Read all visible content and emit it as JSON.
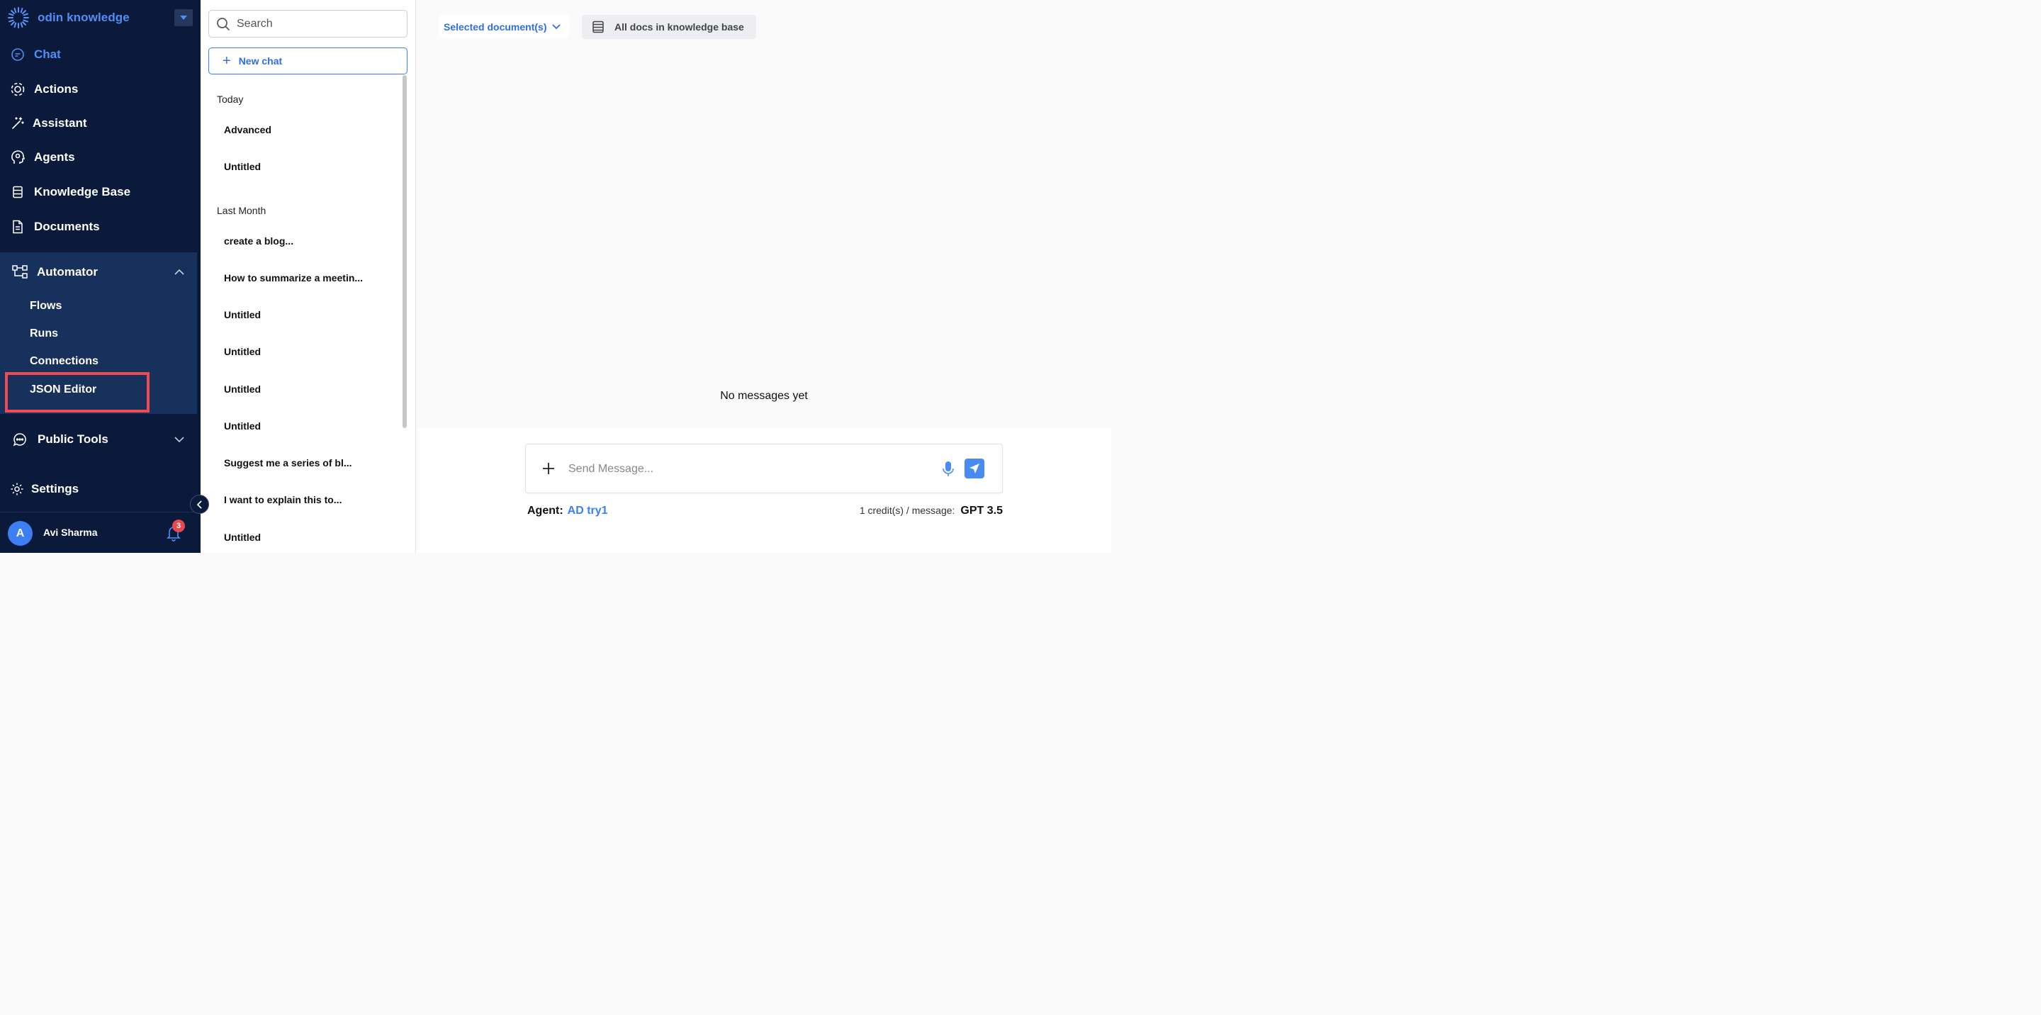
{
  "brand": {
    "name": "odin knowledge"
  },
  "nav": {
    "chat": "Chat",
    "actions": "Actions",
    "assistant": "Assistant",
    "agents": "Agents",
    "knowledge_base": "Knowledge Base",
    "documents": "Documents",
    "automator": "Automator",
    "automator_items": [
      "Flows",
      "Runs",
      "Connections",
      "JSON Editor"
    ],
    "public_tools": "Public Tools",
    "settings": "Settings"
  },
  "user": {
    "initial": "A",
    "name": "Avi Sharma",
    "notifications": "3"
  },
  "chatlist": {
    "search_placeholder": "Search",
    "new_chat": "New chat",
    "groups": [
      {
        "label": "Today",
        "items": [
          "Advanced",
          "Untitled"
        ]
      },
      {
        "label": "Last Month",
        "items": [
          "create a blog...",
          "How to summarize a meetin...",
          "Untitled",
          "Untitled",
          "Untitled",
          "Untitled",
          "Suggest me a series of bl...",
          "I want to explain this to...",
          "Untitled"
        ]
      }
    ]
  },
  "main": {
    "doc_select": "Selected document(s)",
    "all_docs": "All docs in knowledge base",
    "empty": "No messages yet",
    "composer_placeholder": "Send Message...",
    "agent_label": "Agent:",
    "agent_name": "AD try1",
    "credits": "1 credit(s) / message:",
    "model": "GPT 3.5"
  },
  "colors": {
    "sidebar": "#0b1a3a",
    "accent": "#3b7ff2",
    "highlight": "#ee4c52"
  }
}
